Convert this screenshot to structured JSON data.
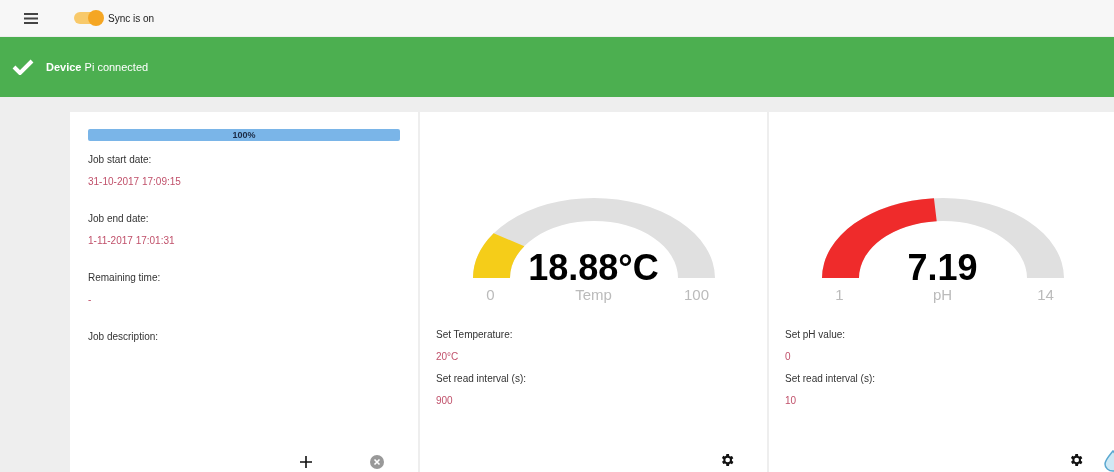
{
  "top_bar": {
    "sync_toggle": {
      "on": true,
      "label": "Sync is on"
    }
  },
  "banner": {
    "title": "Device",
    "message": "Pi connected"
  },
  "job_card": {
    "progress": {
      "level": 1.0,
      "label": "100%"
    },
    "fields": [
      {
        "label": "Job start date:",
        "value": "31-10-2017 17:09:15"
      },
      {
        "label": "Job end date:",
        "value": "1-11-2017 17:01:31"
      },
      {
        "label": "Remaining time:",
        "value": "-"
      },
      {
        "label": "Job description:"
      }
    ]
  },
  "sensor_cards": [
    {
      "gauge": {
        "color": "#f5cd19",
        "value": "18.88°C",
        "min": "0",
        "max": "100",
        "unit": "Temp"
      },
      "settings": [
        {
          "label": "Set Temperature:",
          "value": "20°C"
        },
        {
          "label": "Set read interval (s):",
          "value": "900"
        }
      ]
    },
    {
      "gauge": {
        "color": "#ef2b2b",
        "value": "7.19",
        "min": "1",
        "max": "14",
        "unit": "pH"
      },
      "settings": [
        {
          "label": "Set pH value:",
          "value": "0"
        },
        {
          "label": "Set read interval (s):",
          "value": "10"
        }
      ]
    }
  ]
}
